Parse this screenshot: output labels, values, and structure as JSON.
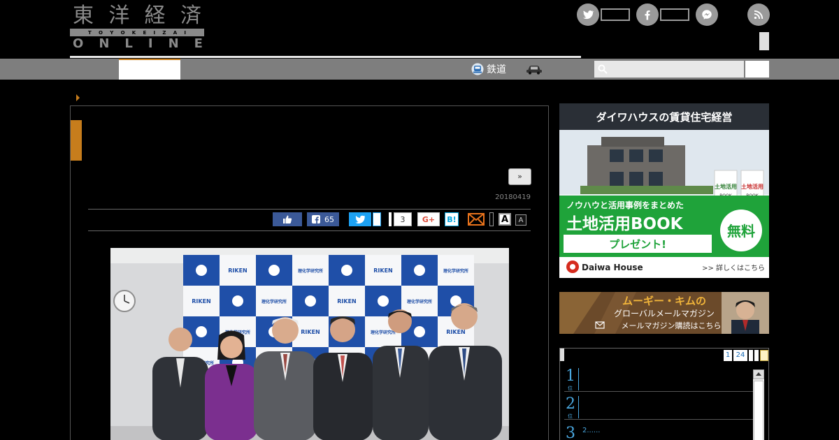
{
  "header": {
    "logo_kanji": [
      "東",
      "洋",
      "経",
      "済"
    ],
    "logo_roman": [
      "T",
      "O",
      "Y",
      "O",
      "K",
      "E",
      "I",
      "Z",
      "A",
      "I"
    ],
    "logo_online": [
      "O",
      "N",
      "L",
      "I",
      "N",
      "E"
    ]
  },
  "nav": {
    "links": [
      {
        "label": "鉄道",
        "icon": "train-icon"
      },
      {
        "label": "",
        "icon": "car-icon"
      }
    ],
    "search_placeholder": ""
  },
  "article": {
    "next_label": "»",
    "date": "20180419",
    "share": {
      "facebook_count": "65",
      "hatena_count": "3",
      "gplus_label": "G+",
      "hatena_label": "B!",
      "font_large": "A",
      "font_small": "A"
    }
  },
  "photo": {
    "backdrop_cell_texts": [
      "理化学研究所",
      "RIKEN"
    ]
  },
  "sidebar": {
    "daiwa_ad": {
      "headline": "ダイワハウスの賃貸住宅経営",
      "sub": "ノウハウと活用事例をまとめた",
      "book": "土地活用BOOK",
      "free": "無料",
      "present": "プレゼント!",
      "brand": "Daiwa House",
      "more": ">> 詳しくはこちら",
      "book_cover_title": "土地活用",
      "book_cover_sub": "BOOK"
    },
    "kim_ad": {
      "name": "ムーギー・キムの",
      "title": "グローバルメールマガジン",
      "cta": "メールマガジン購読はこちら"
    },
    "ranking": {
      "tabs": [
        "1",
        "24"
      ],
      "items": [
        {
          "rank": "1",
          "unit": "位",
          "text": ""
        },
        {
          "rank": "2",
          "unit": "位",
          "text": ""
        },
        {
          "rank": "3",
          "unit": "",
          "text": "2......"
        }
      ]
    }
  }
}
